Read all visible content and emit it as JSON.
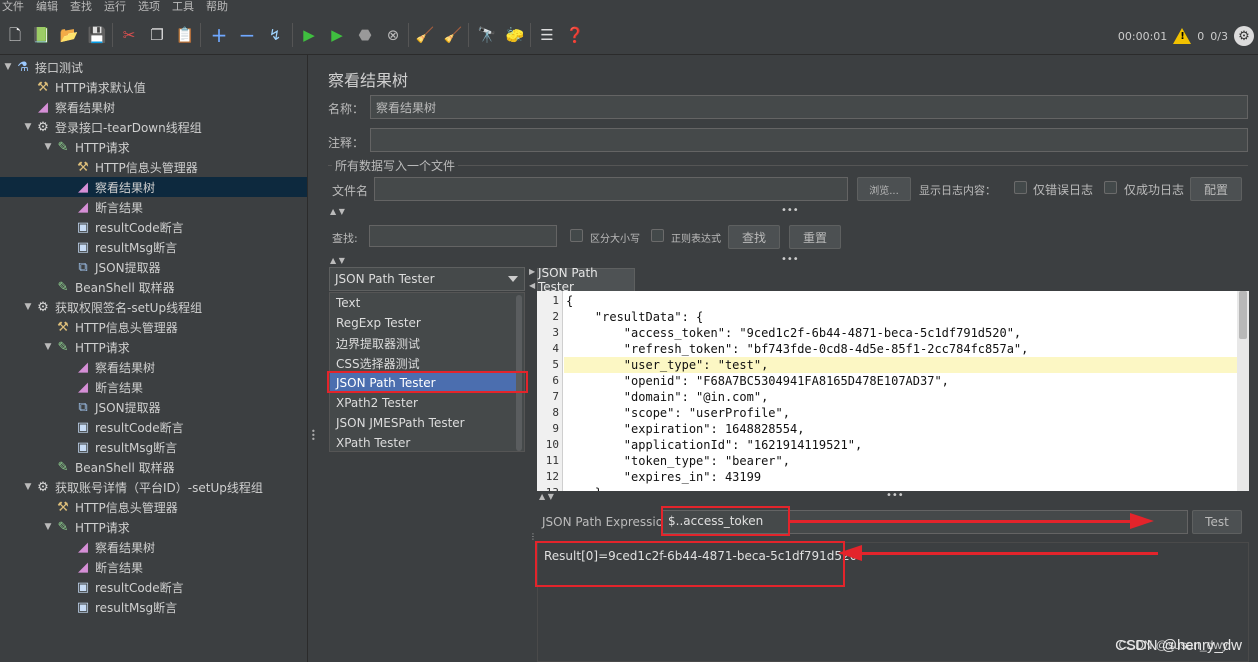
{
  "menu": [
    "文件",
    "编辑",
    "查找",
    "运行",
    "选项",
    "工具",
    "帮助"
  ],
  "toolbar": {
    "timer": "00:00:01",
    "warning_count": "0",
    "threads": "0/3",
    "icons": [
      "new-icon",
      "templates-icon",
      "open-icon",
      "save-icon",
      "cut-icon",
      "copy-icon",
      "paste-icon",
      "expand-icon",
      "collapse-icon",
      "toggle-icon",
      "start-icon",
      "start-no-pause-icon",
      "stop-icon",
      "shutdown-icon",
      "clear-icon",
      "clear-all-icon",
      "search-icon",
      "reset-search-icon",
      "function-helper-icon",
      "help-icon"
    ]
  },
  "tree": [
    {
      "label": "接口测试",
      "icon": "flask-icon",
      "depth": 0,
      "arrow": "▼"
    },
    {
      "label": "HTTP请求默认值",
      "icon": "tool-icon",
      "depth": 1,
      "arrow": ""
    },
    {
      "label": "察看结果树",
      "icon": "chart-icon",
      "depth": 1,
      "arrow": ""
    },
    {
      "label": "登录接口-tearDown线程组",
      "icon": "gear-icon",
      "depth": 1,
      "arrow": "▼"
    },
    {
      "label": "HTTP请求",
      "icon": "pen-icon",
      "depth": 2,
      "arrow": "▼"
    },
    {
      "label": "HTTP信息头管理器",
      "icon": "tool-icon",
      "depth": 3,
      "arrow": ""
    },
    {
      "label": "察看结果树",
      "icon": "chart-icon",
      "depth": 3,
      "arrow": "",
      "selected": true
    },
    {
      "label": "断言结果",
      "icon": "chart-icon",
      "depth": 3,
      "arrow": ""
    },
    {
      "label": "resultCode断言",
      "icon": "assert-icon",
      "depth": 3,
      "arrow": ""
    },
    {
      "label": "resultMsg断言",
      "icon": "assert-icon",
      "depth": 3,
      "arrow": ""
    },
    {
      "label": "JSON提取器",
      "icon": "json-icon",
      "depth": 3,
      "arrow": ""
    },
    {
      "label": "BeanShell 取样器",
      "icon": "pen-icon",
      "depth": 2,
      "arrow": ""
    },
    {
      "label": "获取权限签名-setUp线程组",
      "icon": "gear-icon",
      "depth": 1,
      "arrow": "▼"
    },
    {
      "label": "HTTP信息头管理器",
      "icon": "tool-icon",
      "depth": 2,
      "arrow": ""
    },
    {
      "label": "HTTP请求",
      "icon": "pen-icon",
      "depth": 2,
      "arrow": "▼"
    },
    {
      "label": "察看结果树",
      "icon": "chart-icon",
      "depth": 3,
      "arrow": ""
    },
    {
      "label": "断言结果",
      "icon": "chart-icon",
      "depth": 3,
      "arrow": ""
    },
    {
      "label": "JSON提取器",
      "icon": "json-icon",
      "depth": 3,
      "arrow": ""
    },
    {
      "label": "resultCode断言",
      "icon": "assert-icon",
      "depth": 3,
      "arrow": ""
    },
    {
      "label": "resultMsg断言",
      "icon": "assert-icon",
      "depth": 3,
      "arrow": ""
    },
    {
      "label": "BeanShell 取样器",
      "icon": "pen-icon",
      "depth": 2,
      "arrow": ""
    },
    {
      "label": "获取账号详情（平台ID）-setUp线程组",
      "icon": "gear-icon",
      "depth": 1,
      "arrow": "▼"
    },
    {
      "label": "HTTP信息头管理器",
      "icon": "tool-icon",
      "depth": 2,
      "arrow": ""
    },
    {
      "label": "HTTP请求",
      "icon": "pen-icon",
      "depth": 2,
      "arrow": "▼"
    },
    {
      "label": "察看结果树",
      "icon": "chart-icon",
      "depth": 3,
      "arrow": ""
    },
    {
      "label": "断言结果",
      "icon": "chart-icon",
      "depth": 3,
      "arrow": ""
    },
    {
      "label": "resultCode断言",
      "icon": "assert-icon",
      "depth": 3,
      "arrow": ""
    },
    {
      "label": "resultMsg断言",
      "icon": "assert-icon",
      "depth": 3,
      "arrow": ""
    }
  ],
  "panel": {
    "title": "察看结果树",
    "name_label": "名称：",
    "name_value": "察看结果树",
    "comment_label": "注释：",
    "comment_value": "",
    "file_section": "所有数据写入一个文件",
    "filename_label": "文件名",
    "filename_value": "",
    "browse_button": "浏览...",
    "log_label": "显示日志内容：",
    "errors_only": "仅错误日志",
    "success_only": "仅成功日志",
    "config_button": "配置",
    "search_label": "查找:",
    "search_value": "",
    "case_sensitive": "区分大小写",
    "regex": "正则表达式",
    "find_button": "查找",
    "reset_button": "重置"
  },
  "renderer": {
    "selected": "JSON Path Tester",
    "options": [
      "Text",
      "RegExp Tester",
      "边界提取器测试",
      "CSS选择器测试",
      "JSON Path Tester",
      "XPath2 Tester",
      "JSON JMESPath Tester",
      "XPath Tester"
    ],
    "selected_index": 4
  },
  "tester": {
    "tab_label": "JSON Path Tester",
    "code_lines": [
      "{",
      "    \"resultData\": {",
      "        \"access_token\": \"9ced1c2f-6b44-4871-beca-5c1df791d520\",",
      "        \"refresh_token\": \"bf743fde-0cd8-4d5e-85f1-2cc784fc857a\",",
      "        \"user_type\": \"test\",",
      "        \"openid\": \"F68A7BC5304941FA8165D478E107AD37\",",
      "        \"domain\": \"@in.com\",",
      "        \"scope\": \"userProfile\",",
      "        \"expiration\": 1648828554,",
      "        \"applicationId\": \"1621914119521\",",
      "        \"token_type\": \"bearer\",",
      "        \"expires_in\": 43199",
      "    },"
    ],
    "highlight_line": 5,
    "expression_label": "JSON Path Expression",
    "expression_value": "$..access_token",
    "test_button": "Test",
    "result": "Result[0]=9ced1c2f-6b44-4871-beca-5c1df791d520"
  },
  "watermark": "CSDN @henry_dw",
  "watermark_secondary": "CSDN @susan_dwy",
  "colors": {
    "background": "#3c3f41",
    "selection": "#4b6eaf",
    "annotation_red": "#e3242b",
    "highlight_line": "#fcf7c4"
  }
}
